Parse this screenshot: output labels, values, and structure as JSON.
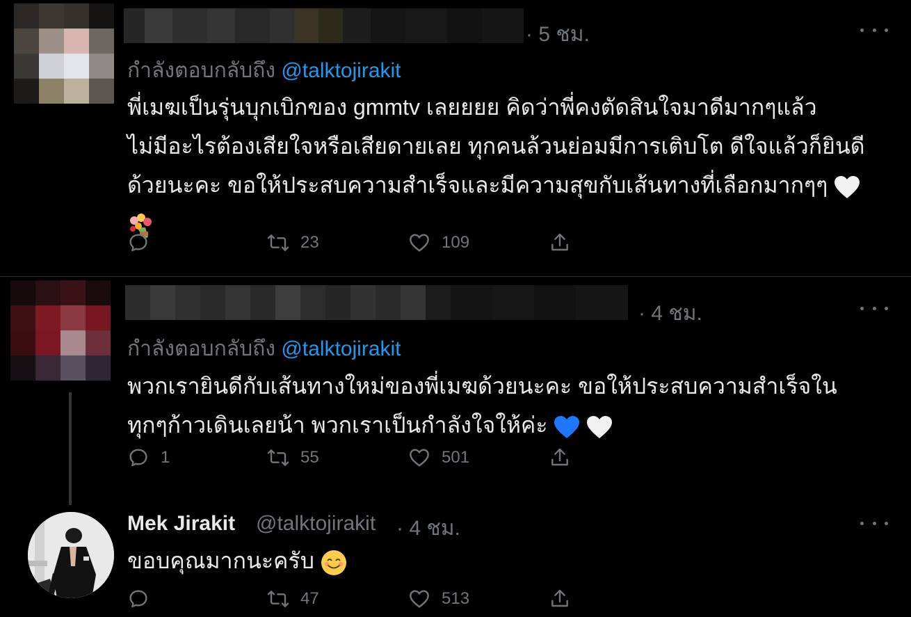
{
  "replies": [
    {
      "time": "· 5 ชม.",
      "replying_label": "กำลังตอบกลับถึง",
      "replying_handle": "@talktojirakit",
      "lines": [
        "พี่เมฆเป็นรุ่นบุกเบิกของ gmmtv เลยยยย คิดว่าพี่คงตัดสินใจมาดีมากๆแล้ว",
        "ไม่มีอะไรต้องเสียใจหรือเสียดายเลย ทุกคนล้วนย่อมมีการเติบโต ดีใจแล้วก็ยินดี",
        "ด้วยนะคะ ขอให้ประสบความสำเร็จและมีความสุขกับเส้นทางที่เลือกมากๆๆ"
      ],
      "emojis": [
        "white-heart",
        "bouquet"
      ],
      "stats": {
        "reply": "",
        "retweet": "23",
        "like": "109"
      }
    },
    {
      "time": "· 4 ชม.",
      "replying_label": "กำลังตอบกลับถึง",
      "replying_handle": "@talktojirakit",
      "lines": [
        "พวกเรายินดีกับเส้นทางใหม่ของพี่เมฆด้วยนะคะ ขอให้ประสบความสำเร็จใน",
        "ทุกๆก้าวเดินเลยน้า พวกเราเป็นกำลังใจให้ค่ะ"
      ],
      "emojis": [
        "blue-heart",
        "white-heart"
      ],
      "stats": {
        "reply": "1",
        "retweet": "55",
        "like": "501"
      }
    },
    {
      "author_name": "Mek Jirakit",
      "author_handle": "@talktojirakit",
      "time": "· 4 ชม.",
      "lines": [
        "ขอบคุณมากนะครับ"
      ],
      "emojis": [
        "smiling-face"
      ],
      "stats": {
        "reply": "",
        "retweet": "47",
        "like": "513"
      }
    }
  ],
  "colors": {
    "background": "#000000",
    "text": "#e7e9ea",
    "muted": "#71767b",
    "accent": "#1d9bf0",
    "divider": "#2f3336"
  }
}
